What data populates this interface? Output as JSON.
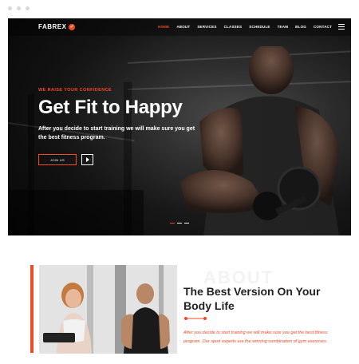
{
  "brand": {
    "name": "FABREX"
  },
  "nav": {
    "items": [
      {
        "label": "HOME",
        "active": true
      },
      {
        "label": "ABOUT",
        "active": false
      },
      {
        "label": "SERVICES",
        "active": false
      },
      {
        "label": "CLASSES",
        "active": false
      },
      {
        "label": "SCHEDULE",
        "active": false
      },
      {
        "label": "TEAM",
        "active": false
      },
      {
        "label": "BLOG",
        "active": false
      },
      {
        "label": "CONTACT",
        "active": false
      }
    ]
  },
  "hero": {
    "tagline": "WE RAISE YOUR CONFIDENCE",
    "headline": "Get Fit to Happy",
    "subtext": "After you decide to start training we will make sure you get the best fitness program.",
    "join_label": "JOIN US"
  },
  "about": {
    "watermark": "ABOUT",
    "title": "The Best Version On Your Body Life",
    "text": "After you decide to start training we will make sure you get the best fitness program. Our sport experts are the winning combination of gym exercises."
  },
  "colors": {
    "accent": "#f04a24",
    "dark": "#1a1a1a"
  }
}
